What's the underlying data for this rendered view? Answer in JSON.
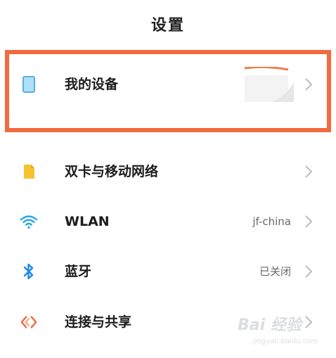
{
  "header": {
    "title": "设置"
  },
  "items": [
    {
      "label": "我的设备",
      "value": "",
      "icon": "device-icon"
    },
    {
      "label": "双卡与移动网络",
      "value": "",
      "icon": "sim-card-icon"
    },
    {
      "label": "WLAN",
      "value": "jf-china",
      "icon": "wifi-icon"
    },
    {
      "label": "蓝牙",
      "value": "已关闭",
      "icon": "bluetooth-icon"
    },
    {
      "label": "连接与共享",
      "value": "",
      "icon": "connection-share-icon"
    }
  ],
  "watermark": {
    "text": "Bai 经验",
    "sub": "jingyan.baidu.com"
  },
  "colors": {
    "highlight": "#f26a3d",
    "device": "#7cc8f0",
    "sim": "#f7c230",
    "wifi": "#2aa6e8",
    "bluetooth": "#1e88e5",
    "share": "#f26a3d",
    "chevron": "#b5b5b5"
  }
}
